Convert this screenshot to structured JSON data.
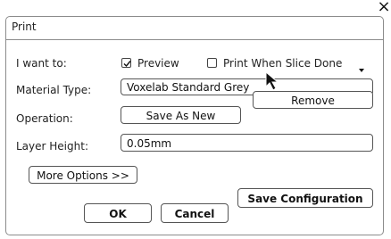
{
  "window": {
    "close_glyph": "×"
  },
  "dialog": {
    "title": "Print"
  },
  "form": {
    "want_label": "I want to:",
    "preview_label": "Preview",
    "preview_checked": true,
    "slice_label": "Print When Slice Done",
    "slice_checked": false,
    "material_label": "Material Type:",
    "material_value": "Voxelab Standard Grey",
    "remove_label": "Remove",
    "operation_label": "Operation:",
    "save_as_new_label": "Save As New",
    "layer_height_label": "Layer Height:",
    "layer_height_value": "0.05mm",
    "more_options_label": "More Options >>",
    "save_config_label": "Save Configuration",
    "ok_label": "OK",
    "cancel_label": "Cancel"
  },
  "icons": {
    "close": "close-icon",
    "check": "checkmark-icon",
    "caret": "chevron-down-icon",
    "cursor": "mouse-pointer-icon"
  }
}
